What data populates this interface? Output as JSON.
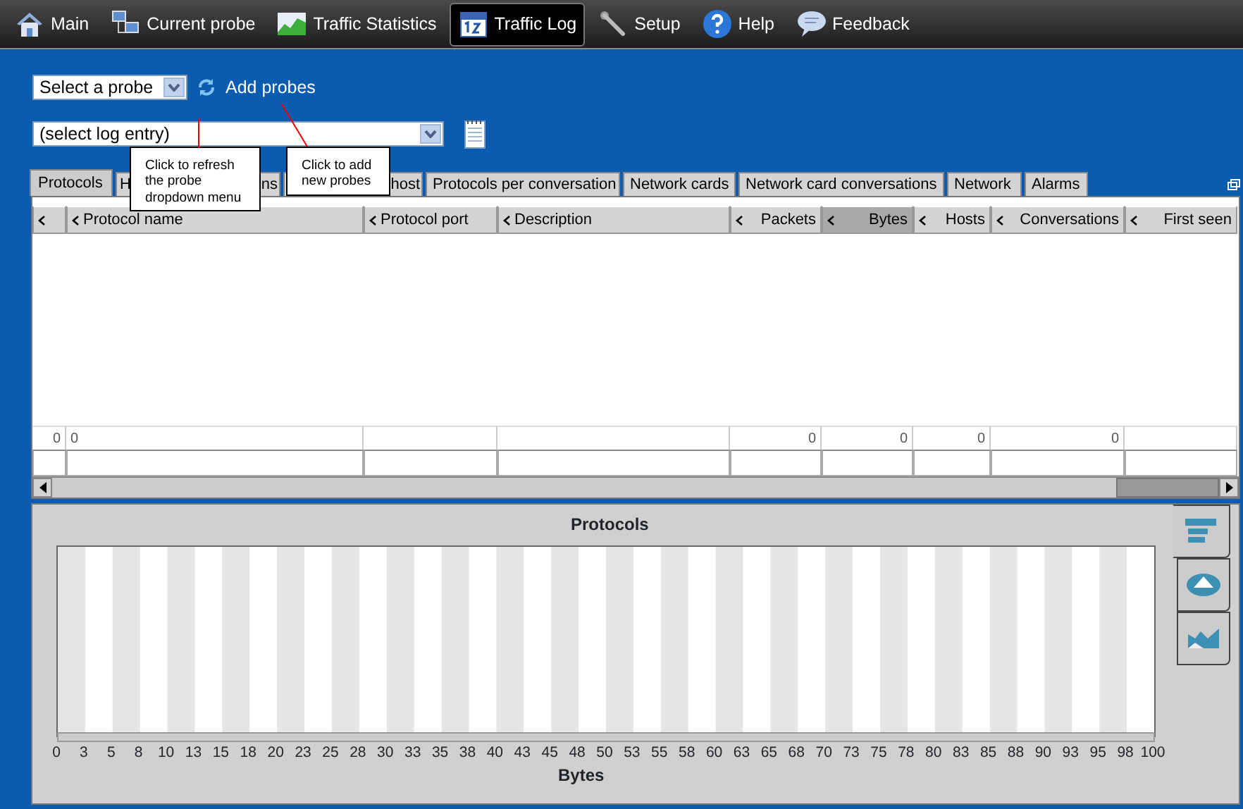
{
  "toolbar": [
    {
      "label": "Main",
      "selected": false
    },
    {
      "label": "Current probe",
      "selected": false
    },
    {
      "label": "Traffic Statistics",
      "selected": false
    },
    {
      "label": "Traffic Log",
      "selected": true
    },
    {
      "label": "Setup",
      "selected": false
    },
    {
      "label": "Help",
      "selected": false
    },
    {
      "label": "Feedback",
      "selected": false
    }
  ],
  "probe_select": {
    "value": "Select a probe"
  },
  "add_probes": "Add probes",
  "log_select": {
    "value": "(select log entry)"
  },
  "tooltips": [
    {
      "text": "Click to refresh the probe dropdown menu"
    },
    {
      "text": "Click to add new probes"
    }
  ],
  "tabs": [
    {
      "label": "Protocols",
      "selected": true
    },
    {
      "label_start": "H",
      "label_end": "ns",
      "selected": false
    },
    {
      "label_end": "host",
      "selected": false
    },
    {
      "label": "Protocols per conversation",
      "selected": false
    },
    {
      "label": "Network cards",
      "selected": false
    },
    {
      "label": "Network card conversations",
      "selected": false
    },
    {
      "label": "Network",
      "selected": false
    },
    {
      "label": "Alarms",
      "selected": false
    }
  ],
  "table": {
    "columns": [
      {
        "total": "0"
      },
      {
        "label": "Protocol name",
        "sorted": false,
        "total": "0"
      },
      {
        "label": "Protocol port",
        "sorted": false
      },
      {
        "label": "Description",
        "sorted": false
      },
      {
        "label": "Packets",
        "sorted": false,
        "total": "0"
      },
      {
        "label": "Bytes",
        "sorted": true,
        "total": "0"
      },
      {
        "label": "Hosts",
        "sorted": false,
        "total": "0"
      },
      {
        "label": "Conversations",
        "sorted": false,
        "total": "0"
      },
      {
        "label": "First seen",
        "sorted": false
      }
    ]
  },
  "chart": {
    "title": "Protocols",
    "xlabel": "Bytes",
    "ticks": [
      "0",
      "3",
      "5",
      "8",
      "10",
      "13",
      "15",
      "18",
      "20",
      "23",
      "25",
      "28",
      "30",
      "33",
      "35",
      "38",
      "40",
      "43",
      "45",
      "48",
      "50",
      "53",
      "55",
      "58",
      "60",
      "63",
      "65",
      "68",
      "70",
      "73",
      "75",
      "78",
      "80",
      "83",
      "85",
      "88",
      "90",
      "93",
      "95",
      "98",
      "100"
    ]
  },
  "chart_tabs": [
    {
      "selected": true
    },
    {
      "selected": false
    },
    {
      "selected": false
    }
  ]
}
